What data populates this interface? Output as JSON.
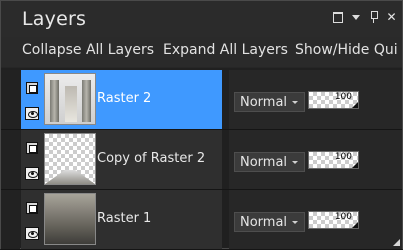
{
  "panel": {
    "title": "Layers"
  },
  "toolbar": {
    "collapse_all_label": "Collapse All Layers",
    "expand_all_label": "Expand All Layers",
    "show_hide_label": "Show/Hide Qui"
  },
  "layers": [
    {
      "name": "Raster 2",
      "blend_mode": "Normal",
      "opacity": "100",
      "selected": true
    },
    {
      "name": "Copy of Raster 2",
      "blend_mode": "Normal",
      "opacity": "100",
      "selected": false
    },
    {
      "name": "Raster 1",
      "blend_mode": "Normal",
      "opacity": "100",
      "selected": false
    }
  ],
  "colors": {
    "selected_accent": "#3f99ff",
    "panel_background": "#262626"
  }
}
